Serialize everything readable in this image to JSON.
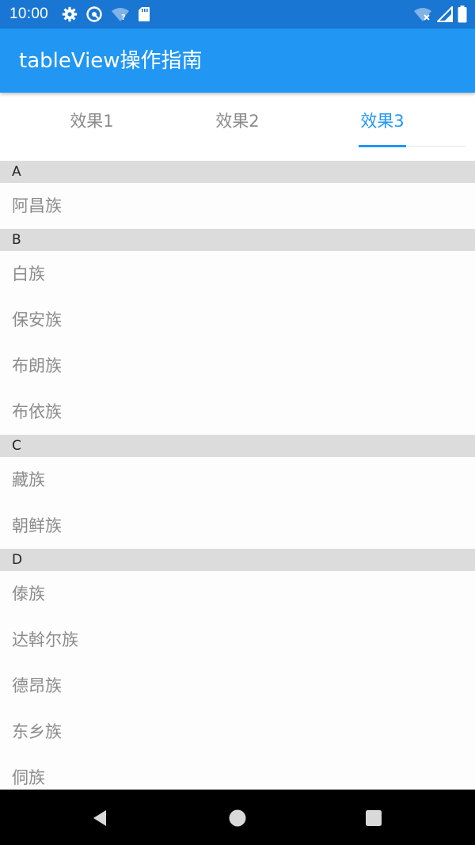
{
  "status_bar": {
    "time": "10:00",
    "left_icons": [
      "gear-icon",
      "vpn-key-icon",
      "wifi-question-icon",
      "sd-card-icon"
    ],
    "right_icons": [
      "wifi-x-icon",
      "signal-icon",
      "battery-icon"
    ]
  },
  "app_bar": {
    "title": "tableView操作指南"
  },
  "tabs": [
    {
      "label": "效果1",
      "active": false
    },
    {
      "label": "效果2",
      "active": false
    },
    {
      "label": "效果3",
      "active": true
    }
  ],
  "list": {
    "sections": [
      {
        "header": "A",
        "items": [
          "阿昌族"
        ]
      },
      {
        "header": "B",
        "items": [
          "白族",
          "保安族",
          "布朗族",
          "布依族"
        ]
      },
      {
        "header": "C",
        "items": [
          "藏族",
          "朝鲜族"
        ]
      },
      {
        "header": "D",
        "items": [
          "傣族",
          "达斡尔族",
          "德昂族",
          "东乡族",
          "侗族"
        ]
      }
    ]
  },
  "nav_bar": {
    "buttons": [
      "back-icon",
      "home-icon",
      "recents-icon"
    ]
  },
  "colors": {
    "status_bar": "#1976d2",
    "app_bar": "#2196f3",
    "accent": "#2196f3",
    "section_header": "#dcdcdc",
    "item_text": "#8c8c8c"
  }
}
